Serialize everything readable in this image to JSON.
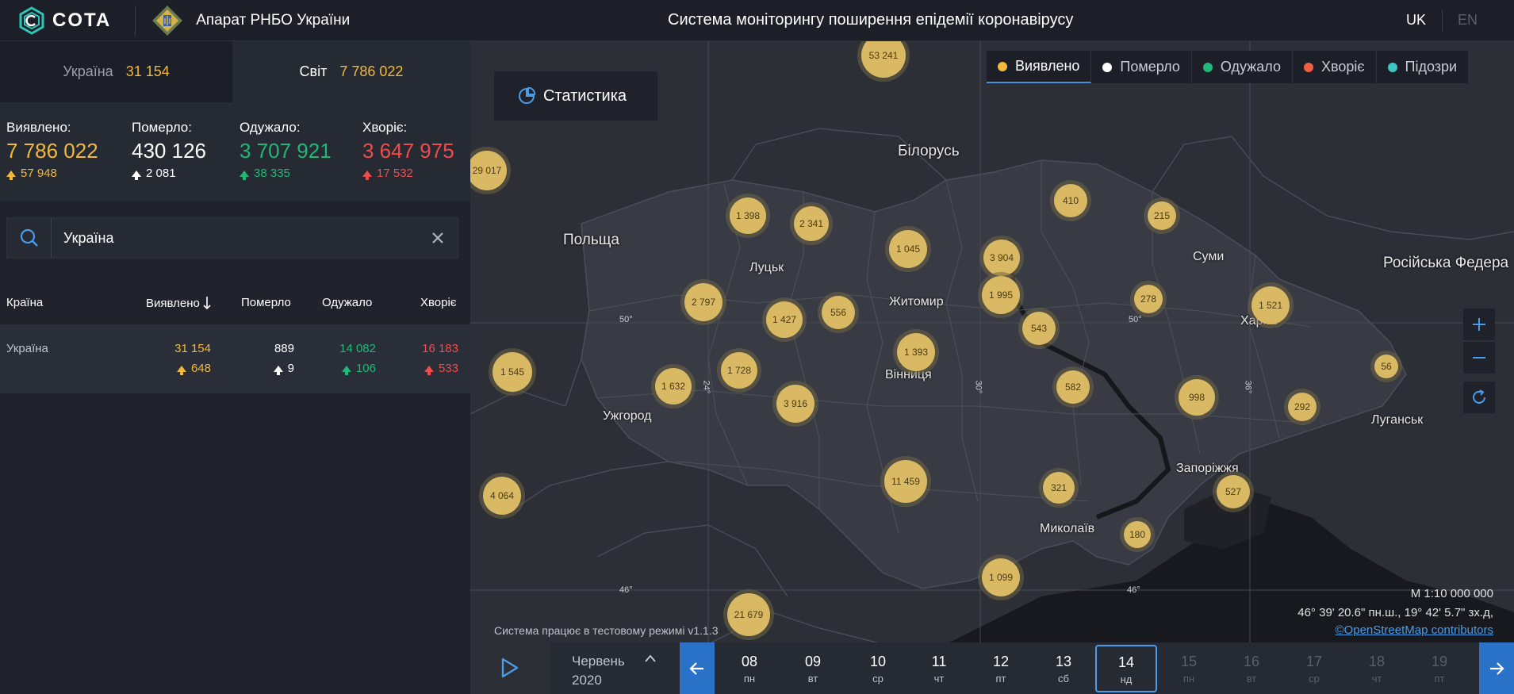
{
  "header": {
    "logo_text": "COTA",
    "org": "Апарат РНБО України",
    "title": "Система моніторингу поширення епідемії коронавірусу",
    "lang_uk": "UK",
    "lang_en": "EN"
  },
  "scope": {
    "ukraine_label": "Україна",
    "ukraine_value": "31 154",
    "world_label": "Світ",
    "world_value": "7 786 022"
  },
  "stats": [
    {
      "label": "Виявлено:",
      "value": "7 786 022",
      "delta": "57 948",
      "color": "#f1b83a"
    },
    {
      "label": "Померло:",
      "value": "430 126",
      "delta": "2 081",
      "color": "#ffffff"
    },
    {
      "label": "Одужало:",
      "value": "3 707 921",
      "delta": "38 335",
      "color": "#1fb876"
    },
    {
      "label": "Хворіє:",
      "value": "3 647 975",
      "delta": "17 532",
      "color": "#f04c4c"
    }
  ],
  "search": {
    "value": "Україна"
  },
  "table": {
    "headers": {
      "country": "Країна",
      "detected": "Виявлено",
      "died": "Померло",
      "recovered": "Одужало",
      "ill": "Хворіє"
    },
    "rows": [
      {
        "country": "Україна",
        "detected": "31 154",
        "detected_delta": "648",
        "died": "889",
        "died_delta": "9",
        "recovered": "14 082",
        "recovered_delta": "106",
        "ill": "16 183",
        "ill_delta": "533"
      }
    ]
  },
  "map": {
    "stat_button": "Статистика",
    "layers": [
      {
        "label": "Виявлено",
        "color": "#f1b83a"
      },
      {
        "label": "Померло",
        "color": "#ffffff"
      },
      {
        "label": "Одужало",
        "color": "#1fb876"
      },
      {
        "label": "Хворіє",
        "color": "#f06040"
      },
      {
        "label": "Підозри",
        "color": "#3ec4c4"
      }
    ],
    "clusters": [
      "53 241",
      "29 017",
      "1 398",
      "2 341",
      "410",
      "215",
      "1 045",
      "3 904",
      "1 995",
      "2 797",
      "1 427",
      "556",
      "278",
      "1 521",
      "543",
      "1 393",
      "1 545",
      "1 728",
      "1 632",
      "3 916",
      "582",
      "998",
      "56",
      "292",
      "4 064",
      "11 459",
      "321",
      "527",
      "180",
      "1 099",
      "21 679"
    ],
    "places": [
      "Білорусь",
      "Польща",
      "Луцьк",
      "Житомир",
      "Суми",
      "Російська Федера",
      "Харків",
      "Вінниця",
      "Ужгород",
      "Луганськ",
      "Запоріжжя",
      "Миколаїв"
    ],
    "grid_labels": [
      "50°",
      "24°",
      "30°",
      "50°",
      "36°",
      "46°",
      "46°"
    ],
    "scale": "М 1:10 000 000",
    "coords": "46° 39' 20.6\" пн.ш., 19° 42' 5.7\" зх.д,",
    "osm": "©OpenStreetMap contributors",
    "test_mode": "Система працює в тестовому режимі v1.1.3"
  },
  "timeline": {
    "month": "Червень",
    "year": "2020",
    "days": [
      {
        "d": "08",
        "w": "пн"
      },
      {
        "d": "09",
        "w": "вт"
      },
      {
        "d": "10",
        "w": "ср"
      },
      {
        "d": "11",
        "w": "чт"
      },
      {
        "d": "12",
        "w": "пт"
      },
      {
        "d": "13",
        "w": "сб"
      },
      {
        "d": "14",
        "w": "нд"
      },
      {
        "d": "15",
        "w": "пн"
      },
      {
        "d": "16",
        "w": "вт"
      },
      {
        "d": "17",
        "w": "ср"
      },
      {
        "d": "18",
        "w": "чт"
      },
      {
        "d": "19",
        "w": "пт"
      }
    ],
    "selected_day": "14"
  }
}
